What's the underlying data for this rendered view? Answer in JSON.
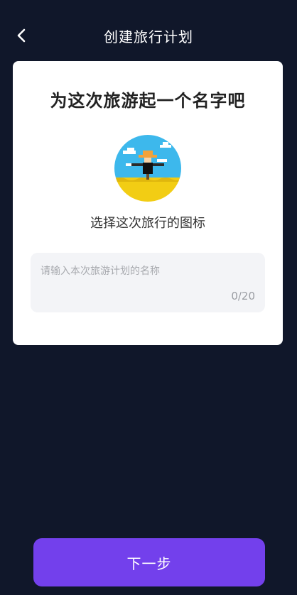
{
  "header": {
    "title": "创建旅行计划",
    "back_icon": "chevron-left-icon"
  },
  "card": {
    "heading": "为这次旅游起一个名字吧",
    "icon_caption": "选择这次旅行的图标",
    "trip_icon": "scarecrow-field-icon",
    "name_input": {
      "placeholder": "请输入本次旅游计划的名称",
      "value": "",
      "counter": "0/20"
    }
  },
  "footer": {
    "next_label": "下一步"
  },
  "colors": {
    "background": "#10172a",
    "card": "#ffffff",
    "accent": "#7340ec",
    "input_bg": "#f3f4f7"
  }
}
